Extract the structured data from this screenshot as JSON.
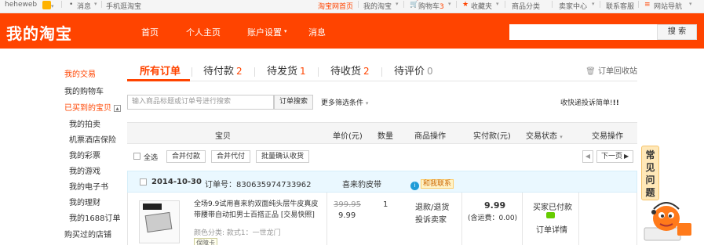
{
  "topbar": {
    "username": "heheweb",
    "messages": "消息",
    "mobile": "手机逛淘宝",
    "home": "淘宝网首页",
    "my_taobao": "我的淘宝",
    "cart": "购物车",
    "cart_count": "3",
    "favorites": "收藏夹",
    "categories": "商品分类",
    "seller_center": "卖家中心",
    "service": "联系客服",
    "site_nav": "网站导航"
  },
  "header": {
    "logo": "我的淘宝",
    "nav": [
      "首页",
      "个人主页",
      "账户设置",
      "消息"
    ],
    "search_button": "搜 索",
    "search_placeholder": ""
  },
  "sidebar": {
    "items": [
      {
        "label": "我的交易"
      },
      {
        "label": "我的购物车"
      },
      {
        "label": "已买到的宝贝"
      },
      {
        "label": "我的拍卖"
      },
      {
        "label": "机票酒店保险"
      },
      {
        "label": "我的彩票"
      },
      {
        "label": "我的游戏"
      },
      {
        "label": "我的电子书"
      },
      {
        "label": "我的理财"
      },
      {
        "label": "我的1688订单"
      },
      {
        "label": "购买过的店铺"
      }
    ]
  },
  "tabs": [
    {
      "label": "所有订单",
      "count": ""
    },
    {
      "label": "待付款",
      "count": "2"
    },
    {
      "label": "待发货",
      "count": "1"
    },
    {
      "label": "待收货",
      "count": "2"
    },
    {
      "label": "待评价",
      "count": "0"
    }
  ],
  "recycle_bin": "订单回收站",
  "order_search": {
    "placeholder": "输入商品标题或订单号进行搜索",
    "button": "订单搜索",
    "more_filters": "更多筛选条件",
    "feedback": "收快递投诉简单!"
  },
  "table_header": [
    "宝贝",
    "单价(元)",
    "数量",
    "商品操作",
    "实付款(元)",
    "交易状态",
    "交易操作"
  ],
  "batch": {
    "select_all": "全选",
    "merge_pay": "合并付款",
    "merge_proxy": "合并代付",
    "batch_confirm": "批量确认收货",
    "next_page": "下一页"
  },
  "order": {
    "date": "2014-10-30",
    "order_no": "订单号：830635974733962",
    "shop": "喜来豹皮带",
    "contact": "和我联系",
    "title": "全场9.9试用喜来豹双面纯头层牛皮真皮带腰带自动扣男士百搭正品",
    "title_tail": "[交易快照]",
    "sku": "颜色分类: 款式1：一世龙门",
    "badge": "保障卡",
    "price_original": "399.95",
    "price": "9.99",
    "quantity": "1",
    "op_refund": "退款/退货",
    "op_complain": "投诉卖家",
    "paid": "9.99",
    "shipping": "(含运费：0.00)",
    "status": "买家已付款",
    "status_detail": "订单详情"
  },
  "help_widget": "常见问题"
}
